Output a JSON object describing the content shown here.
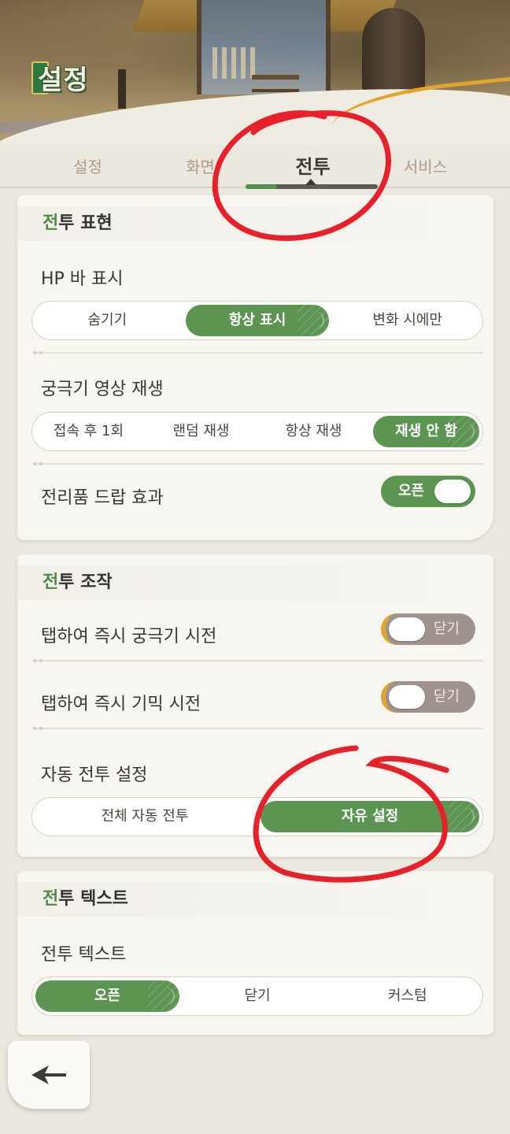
{
  "header": {
    "title": "설정"
  },
  "tabs": [
    {
      "label": "설정",
      "active": false
    },
    {
      "label": "화면",
      "active": false
    },
    {
      "label": "전투",
      "active": true
    },
    {
      "label": "서비스",
      "active": false
    }
  ],
  "sections": {
    "battle_display": {
      "title_accent": "전",
      "title_rest": "투 표현",
      "hp_bar": {
        "label": "HP 바 표시",
        "options": [
          "숨기기",
          "항상 표시",
          "변화 시에만"
        ],
        "selected": "항상 표시"
      },
      "ultimate_video": {
        "label": "궁극기 영상 재생",
        "options": [
          "접속 후 1회",
          "랜덤 재생",
          "항상 재생",
          "재생 안 함"
        ],
        "selected": "재생 안 함"
      },
      "loot_effect": {
        "label": "전리품 드랍 효과",
        "state_text": "오픈",
        "on": true
      }
    },
    "battle_control": {
      "title_accent": "전",
      "title_rest": "투 조작",
      "tap_ultimate": {
        "label": "탭하여 즉시 궁극기 시전",
        "state_text": "닫기",
        "on": false
      },
      "tap_gimmick": {
        "label": "탭하여 즉시 기믹 시전",
        "state_text": "닫기",
        "on": false
      },
      "auto_battle": {
        "label": "자동 전투 설정",
        "options": [
          "전체 자동 전투",
          "자유 설정"
        ],
        "selected": "자유 설정"
      }
    },
    "battle_text": {
      "title_accent": "전",
      "title_rest": "투 텍스트",
      "battle_text_setting": {
        "label": "전투 텍스트",
        "options": [
          "오픈",
          "닫기",
          "커스텀"
        ],
        "selected": "오픈"
      }
    }
  },
  "icons": {
    "back": "back-arrow-icon",
    "title_badge": "settings-badge-icon"
  },
  "colors": {
    "accent_green": "#5c9552",
    "toggle_off": "#9f948d",
    "toggle_off_edge": "#e1a42d",
    "annotation_red": "#e8202a",
    "background": "#ebe8df"
  }
}
